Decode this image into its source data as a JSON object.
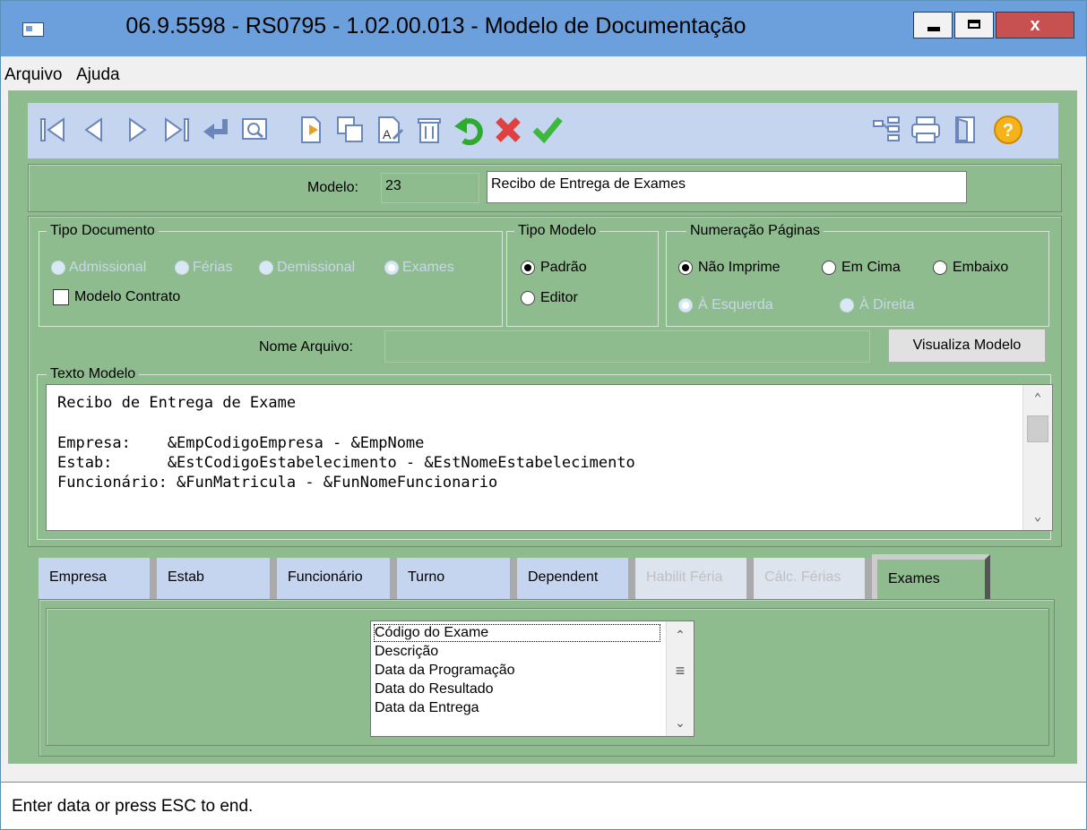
{
  "window": {
    "title": "06.9.5598 - RS0795 - 1.02.00.013 - Modelo de Documentação",
    "close_label": "x"
  },
  "menu": {
    "items": [
      "Arquivo",
      "Ajuda"
    ]
  },
  "toolbar": {
    "left_icons": [
      "first-record-icon",
      "previous-record-icon",
      "next-record-icon",
      "last-record-icon",
      "go-to-icon",
      "query-icon",
      "copy-icon",
      "duplicate-icon",
      "edit-icon",
      "delete-icon",
      "undo-icon",
      "cancel-icon",
      "save-icon"
    ],
    "right_icons": [
      "options-icon",
      "print-icon",
      "exit-icon",
      "help-icon"
    ]
  },
  "modelo": {
    "label": "Modelo:",
    "code": "23",
    "description": "Recibo de Entrega de Exames"
  },
  "tipo_documento": {
    "legend": "Tipo Documento",
    "options": [
      "Admissional",
      "Férias",
      "Demissional",
      "Exames"
    ],
    "selected": "Exames",
    "contract_label": "Modelo Contrato"
  },
  "tipo_modelo": {
    "legend": "Tipo Modelo",
    "options": [
      "Padrão",
      "Editor"
    ],
    "selected": "Padrão"
  },
  "numeracao": {
    "legend": "Numeração Páginas",
    "options": [
      "Não Imprime",
      "Em Cima",
      "Embaixo"
    ],
    "selected": "Não Imprime",
    "align_options": [
      "À Esquerda",
      "À Direita"
    ],
    "align_selected": "À Esquerda"
  },
  "nome_arquivo": {
    "label": "Nome Arquivo:",
    "value": ""
  },
  "visualiza_button": "Visualiza Modelo",
  "texto_modelo": {
    "legend": "Texto Modelo",
    "lines": [
      "Recibo de Entrega de Exame",
      "",
      "Empresa:    &EmpCodigoEmpresa - &EmpNome",
      "Estab:      &EstCodigoEstabelecimento - &EstNomeEstabelecimento",
      "Funcionário: &FunMatricula - &FunNomeFuncionario"
    ]
  },
  "tabs": [
    {
      "label": "Empresa",
      "enabled": true
    },
    {
      "label": "Estab",
      "enabled": true
    },
    {
      "label": "Funcionário",
      "enabled": true
    },
    {
      "label": "Turno",
      "enabled": true
    },
    {
      "label": "Dependent",
      "enabled": true
    },
    {
      "label": "Habilit Féria",
      "enabled": false
    },
    {
      "label": "Cálc. Férias",
      "enabled": false
    },
    {
      "label": "Exames",
      "enabled": true,
      "active": true
    }
  ],
  "exames_fields": [
    "Código do Exame",
    "Descrição",
    "Data da Programação",
    "Data do Resultado",
    "Data da Entrega"
  ],
  "status": "Enter data or press ESC to end.",
  "colors": {
    "panel_green": "#8fbc8f",
    "toolbar_blue": "#c5d5ef",
    "titlebar": "#6ca0dc",
    "close_red": "#c75050"
  }
}
